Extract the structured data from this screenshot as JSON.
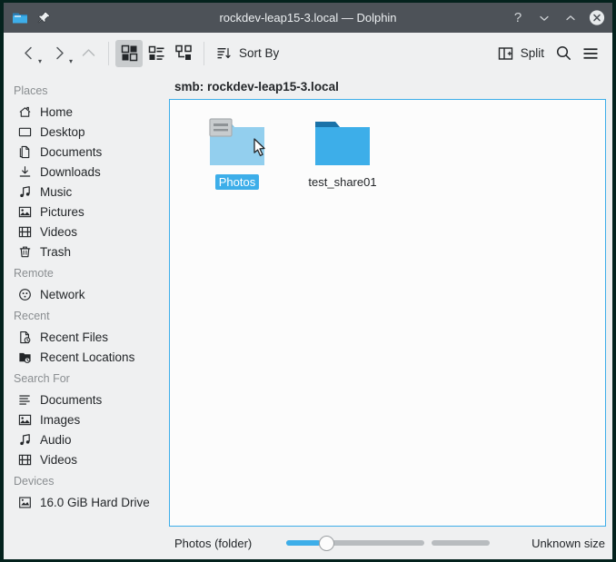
{
  "window": {
    "title": "rockdev-leap15-3.local — Dolphin",
    "app_icon": "folder-icon",
    "pin_icon": "pin-icon",
    "controls": {
      "help": "?",
      "minimize": "minimize-icon",
      "maximize": "maximize-icon",
      "close": "close-icon"
    },
    "titlebar_color": "#4d5258",
    "accent_color": "#3daee9"
  },
  "toolbar": {
    "back_label": "back-icon",
    "forward_label": "forward-icon",
    "up_label": "up-icon",
    "view_icons_label": "view-icons-icon",
    "view_compact_label": "view-compact-icon",
    "view_details_label": "view-details-icon",
    "sort_by_label": "Sort By",
    "split_label": "Split",
    "search_label": "search-icon",
    "menu_label": "menu-icon",
    "active_view": "icons"
  },
  "sidebar": {
    "groups": [
      {
        "title": "Places",
        "items": [
          {
            "label": "Home",
            "icon": "home-icon"
          },
          {
            "label": "Desktop",
            "icon": "desktop-icon"
          },
          {
            "label": "Documents",
            "icon": "documents-icon"
          },
          {
            "label": "Downloads",
            "icon": "downloads-icon"
          },
          {
            "label": "Music",
            "icon": "music-icon"
          },
          {
            "label": "Pictures",
            "icon": "pictures-icon"
          },
          {
            "label": "Videos",
            "icon": "videos-icon"
          },
          {
            "label": "Trash",
            "icon": "trash-icon"
          }
        ]
      },
      {
        "title": "Remote",
        "items": [
          {
            "label": "Network",
            "icon": "network-icon"
          }
        ]
      },
      {
        "title": "Recent",
        "items": [
          {
            "label": "Recent Files",
            "icon": "recent-files-icon"
          },
          {
            "label": "Recent Locations",
            "icon": "recent-locations-icon"
          }
        ]
      },
      {
        "title": "Search For",
        "items": [
          {
            "label": "Documents",
            "icon": "search-documents-icon"
          },
          {
            "label": "Images",
            "icon": "search-images-icon"
          },
          {
            "label": "Audio",
            "icon": "search-audio-icon"
          },
          {
            "label": "Videos",
            "icon": "search-videos-icon"
          }
        ]
      },
      {
        "title": "Devices",
        "items": [
          {
            "label": "16.0 GiB Hard Drive",
            "icon": "harddrive-icon"
          }
        ]
      }
    ]
  },
  "main": {
    "breadcrumb": "smb: rockdev-leap15-3.local",
    "items": [
      {
        "name": "Photos",
        "icon": "folder-mount-icon",
        "selected": true,
        "hovered": true
      },
      {
        "name": "test_share01",
        "icon": "folder-icon",
        "selected": false,
        "hovered": false
      }
    ],
    "cursor": "mouse-pointer"
  },
  "statusbar": {
    "selection_text": "Photos (folder)",
    "size_text": "Unknown size",
    "zoom_value": 25
  }
}
